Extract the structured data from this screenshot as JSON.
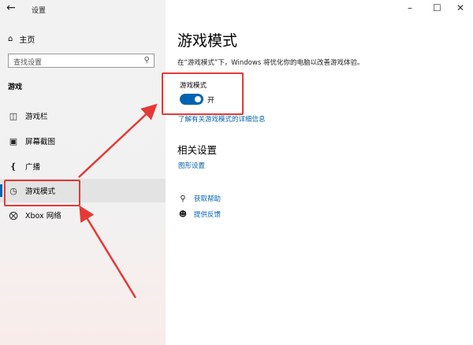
{
  "window": {
    "title": "设置",
    "back_icon": "back-arrow-icon",
    "controls": [
      "minimize-icon",
      "maximize-icon",
      "close-icon"
    ]
  },
  "sidebar": {
    "home_label": "主页",
    "search_placeholder": "查找设置",
    "section": "游戏",
    "items": [
      {
        "label": "游戏栏",
        "icon": "game-bar-icon"
      },
      {
        "label": "屏幕截图",
        "icon": "capture-icon"
      },
      {
        "label": "广播",
        "icon": "broadcast-icon"
      },
      {
        "label": "游戏模式",
        "icon": "game-mode-icon",
        "selected": true
      },
      {
        "label": "Xbox 网络",
        "icon": "xbox-icon"
      }
    ]
  },
  "main": {
    "title": "游戏模式",
    "description": "在“游戏模式”下，Windows 将优化你的电脑以改善游戏体验。",
    "toggle_label": "游戏模式",
    "toggle_state": "开",
    "toggle_on": true,
    "learn_more": "了解有关游戏模式的详细信息",
    "related_heading": "相关设置",
    "related_link": "图形设置",
    "help": [
      {
        "label": "获取帮助",
        "icon": "help-chat-icon"
      },
      {
        "label": "提供反馈",
        "icon": "feedback-icon"
      }
    ]
  },
  "colors": {
    "accent": "#0063b1",
    "annotation": "#e53935"
  }
}
